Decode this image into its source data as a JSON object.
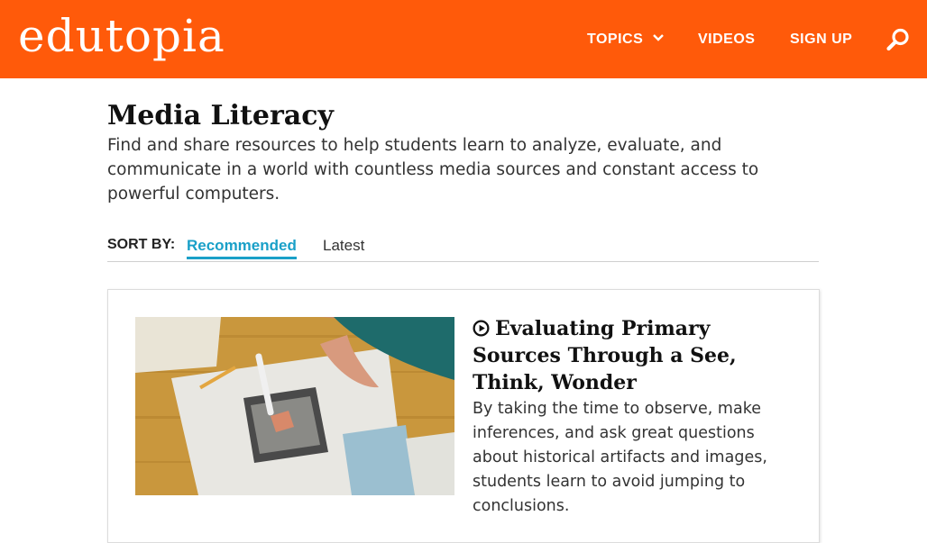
{
  "header": {
    "logo": "edutopia",
    "nav": {
      "topics": "TOPICS",
      "videos": "VIDEOS",
      "signup": "SIGN UP"
    },
    "brand_color": "#ff5a0a",
    "search_icon": "search-icon"
  },
  "page": {
    "title": "Media Literacy",
    "description": "Find and share resources to help students learn to analyze, evaluate, and communicate in a world with countless media sources and constant access to powerful computers."
  },
  "sort": {
    "label": "SORT BY:",
    "options": [
      "Recommended",
      "Latest"
    ],
    "active": "Recommended",
    "active_color": "#1aa0c8"
  },
  "article": {
    "icon": "play-circle-icon",
    "title": "Evaluating Primary Sources Through a See, Think, Wonder",
    "description": "By taking the time to observe, make inferences, and ask great questions about historical artifacts and images, students learn to avoid jumping to conclusions."
  }
}
